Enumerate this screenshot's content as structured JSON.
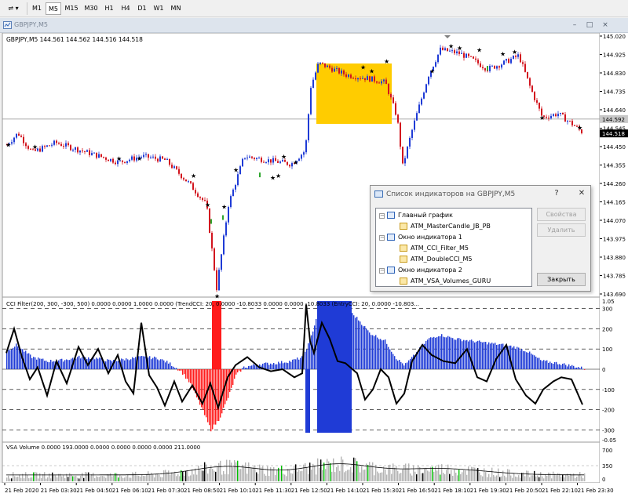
{
  "toolbar": {
    "timeframes": [
      "M1",
      "M5",
      "M15",
      "M30",
      "H1",
      "H4",
      "D1",
      "W1",
      "MN"
    ],
    "active_timeframe": "M5"
  },
  "window": {
    "title": "GBPJPY,M5",
    "controls": [
      "–",
      "□",
      "×"
    ]
  },
  "main_chart": {
    "header": "GBPJPY,M5  144.561 144.562 144.516 144.518",
    "price_scale": [
      "145.020",
      "144.925",
      "144.830",
      "144.735",
      "144.640",
      "144.545",
      "144.450",
      "144.355",
      "144.260",
      "144.165",
      "144.070",
      "143.975",
      "143.880",
      "143.785",
      "143.690"
    ],
    "current_price": "144.518",
    "line_price": "144.592",
    "colors": {
      "bull": "#1f3bd6",
      "bear": "#d2141e",
      "highlight": "#ffcc00",
      "stars": "#000000"
    }
  },
  "cci_window": {
    "header": "CCI Filter(200, 300, -300, 500) 0.0000 0.0000 1.0000 0.0000  (TrendCCI: 20, 0.0000 -10.8033 0.0000 0.0000 -10.8033  (EntryCCI: 20, 0.0000 -10.803...",
    "scale": [
      "1.05",
      "300",
      "200",
      "100",
      "0",
      "-100",
      "-200",
      "-300",
      "-0.05"
    ],
    "colors": {
      "positive": "#1f3bd6",
      "negative": "#ff1b1b",
      "line": "#000000"
    }
  },
  "vsa_window": {
    "header": "VSA Volume 0.0000 193.0000 0.0000 0.0000 0.0000 0.0000 211.0000",
    "scale": [
      "700",
      "350",
      "0"
    ],
    "colors": {
      "normal": "#b4b4b4",
      "high": "#00c000",
      "climax": "#000000"
    }
  },
  "time_axis": [
    "21 Feb 2020",
    "21 Feb 03:30",
    "21 Feb 04:50",
    "21 Feb 06:10",
    "21 Feb 07:30",
    "21 Feb 08:50",
    "21 Feb 10:10",
    "21 Feb 11:30",
    "21 Feb 12:50",
    "21 Feb 14:10",
    "21 Feb 15:30",
    "21 Feb 16:50",
    "21 Feb 18:10",
    "21 Feb 19:30",
    "21 Feb 20:50",
    "21 Feb 22:10",
    "21 Feb 23:30"
  ],
  "dialog": {
    "title": "Список индикаторов на GBPJPY,M5",
    "help": "?",
    "close": "✕",
    "tree": [
      {
        "label": "Главный график",
        "kind": "window",
        "level": 0
      },
      {
        "label": "ATM_MasterCandle_JB_PB",
        "kind": "indicator",
        "level": 1
      },
      {
        "label": "Окно индикатора 1",
        "kind": "window",
        "level": 0
      },
      {
        "label": "ATM_CCI_Filter_M5",
        "kind": "indicator",
        "level": 1
      },
      {
        "label": "ATM_DoubleCCI_M5",
        "kind": "indicator",
        "level": 1
      },
      {
        "label": "Окно индикатора 2",
        "kind": "window",
        "level": 0
      },
      {
        "label": "ATM_VSA_Volumes_GURU",
        "kind": "indicator",
        "level": 1
      }
    ],
    "buttons": {
      "properties": "Свойства",
      "delete": "Удалить",
      "close": "Закрыть"
    }
  }
}
